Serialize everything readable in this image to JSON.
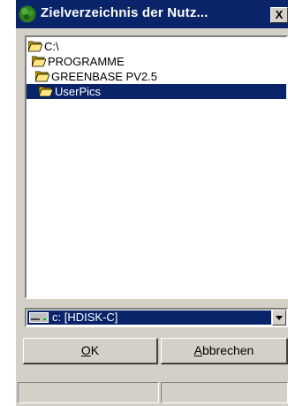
{
  "window": {
    "title": "Zielverzeichnis der Nutz...",
    "close_label": "X"
  },
  "folder_list": {
    "items": [
      {
        "label": "C:\\",
        "selected": false
      },
      {
        "label": "PROGRAMME",
        "selected": false
      },
      {
        "label": "GREENBASE PV2.5",
        "selected": false
      },
      {
        "label": "UserPics",
        "selected": true
      }
    ]
  },
  "drive_select": {
    "value": "c: [HDISK-C]"
  },
  "buttons": {
    "ok_label": "OK",
    "ok_accel": "O",
    "ok_rest": "K",
    "cancel_label": "Abbrechen",
    "cancel_accel": "A",
    "cancel_rest": "bbrechen"
  },
  "status_bar": {
    "left": "",
    "right": ""
  },
  "colors": {
    "titlebar": "#0a246a",
    "face": "#d4d0c8",
    "selection": "#0a246a"
  }
}
